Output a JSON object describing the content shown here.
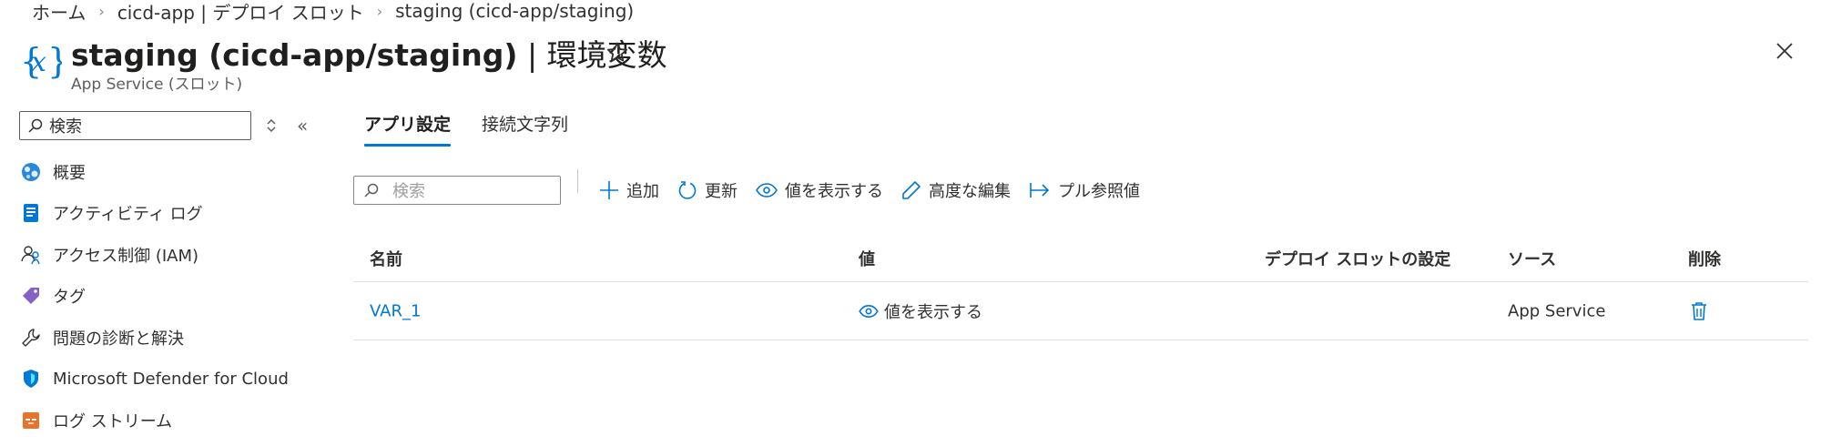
{
  "breadcrumb": [
    "ホーム",
    "cicd-app | デプロイ スロット",
    "staging (cicd-app/staging)"
  ],
  "header": {
    "title_main": "staging (cicd-app/staging)",
    "title_sep": " | ",
    "title_section": "環境変数",
    "subtitle": "App Service (スロット)",
    "more": "···"
  },
  "sidebar": {
    "search_placeholder": "検索",
    "collapse": "«",
    "items": [
      {
        "label": "概要",
        "icon": "globe-icon"
      },
      {
        "label": "アクティビティ ログ",
        "icon": "activity-log-icon"
      },
      {
        "label": "アクセス制御 (IAM)",
        "icon": "people-icon"
      },
      {
        "label": "タグ",
        "icon": "tag-icon"
      },
      {
        "label": "問題の診断と解決",
        "icon": "wrench-icon"
      },
      {
        "label": "Microsoft Defender for Cloud",
        "icon": "shield-icon"
      },
      {
        "label": "ログ ストリーム",
        "icon": "log-stream-icon"
      }
    ]
  },
  "tabs": [
    {
      "label": "アプリ設定",
      "active": true
    },
    {
      "label": "接続文字列",
      "active": false
    }
  ],
  "toolbar": {
    "search_placeholder": "検索",
    "add": "追加",
    "refresh": "更新",
    "show_values": "値を表示する",
    "advanced_edit": "高度な編集",
    "pull_refs": "プル参照値"
  },
  "table": {
    "columns": [
      "名前",
      "値",
      "デプロイ スロットの設定",
      "ソース",
      "削除"
    ],
    "rows": [
      {
        "name": "VAR_1",
        "value": "値を表示する",
        "slot_setting": "",
        "source": "App Service"
      }
    ]
  },
  "colors": {
    "accent": "#0078d4",
    "text": "#323130"
  }
}
